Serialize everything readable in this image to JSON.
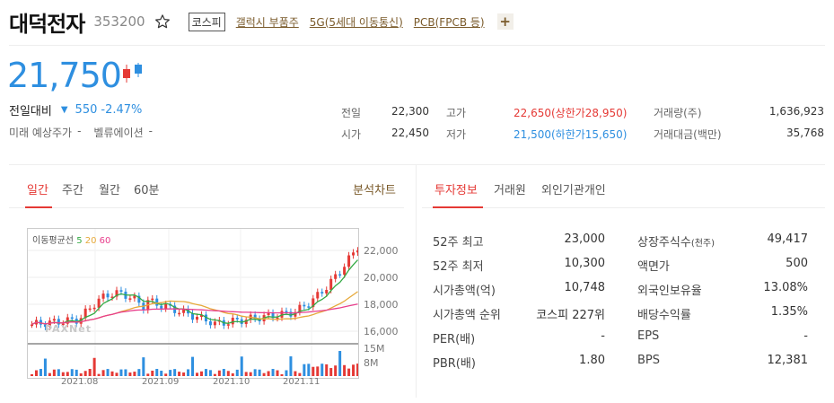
{
  "stock": {
    "name": "대덕전자",
    "code": "353200",
    "market": "코스피",
    "themes": [
      "갤럭시 부품주",
      "5G(5세대 이동통신)",
      "PCB(FPCB 등)"
    ],
    "plus": "+",
    "price": "21,750",
    "change_label": "전일대비",
    "change_value": "550",
    "change_percent": "-2.47%",
    "future_label": "미래 예상주가",
    "future_value": "-",
    "valuation_label": "벨류에이션",
    "valuation_value": "-"
  },
  "quote": {
    "prev_label": "전일",
    "prev": "22,300",
    "open_label": "시가",
    "open": "22,450",
    "high_label": "고가",
    "high": "22,650(상한가28,950)",
    "low_label": "저가",
    "low": "21,500(하한가15,650)",
    "volume_label": "거래량(주)",
    "volume": "1,636,923",
    "amount_label": "거래대금(백만)",
    "amount": "35,768"
  },
  "chart_tabs": [
    "일간",
    "주간",
    "월간",
    "60분"
  ],
  "chart_link": "분석차트",
  "info_tabs": [
    "투자정보",
    "거래원",
    "외인기관개인"
  ],
  "chart": {
    "legend_title": "이동평균선",
    "ma": [
      "5",
      "20",
      "60"
    ],
    "watermark": "PAXNet",
    "y_ticks": [
      "22,000",
      "20,000",
      "18,000",
      "16,000"
    ],
    "vol_ticks": [
      "15M",
      "8M"
    ],
    "x_ticks": [
      "2021.08",
      "2021.09",
      "2021.10",
      "2021.11"
    ]
  },
  "info": {
    "left": [
      {
        "label": "52주 최고",
        "value": "23,000"
      },
      {
        "label": "52주 최저",
        "value": "10,300"
      },
      {
        "label": "시가총액(억)",
        "value": "10,748"
      },
      {
        "label": "시가총액 순위",
        "value": "코스피 227위"
      },
      {
        "label": "PER(배)",
        "value": "-"
      },
      {
        "label": "PBR(배)",
        "value": "1.80"
      }
    ],
    "right": [
      {
        "label": "상장주식수",
        "sub": "(천주)",
        "value": "49,417"
      },
      {
        "label": "액면가",
        "value": "500"
      },
      {
        "label": "외국인보유율",
        "value": "13.08%"
      },
      {
        "label": "배당수익률",
        "value": "1.35%"
      },
      {
        "label": "EPS",
        "value": "-"
      },
      {
        "label": "BPS",
        "value": "12,381"
      }
    ]
  },
  "colors": {
    "up": "#e53935",
    "down": "#2e8fe0",
    "accent": "#7a5a2a"
  }
}
